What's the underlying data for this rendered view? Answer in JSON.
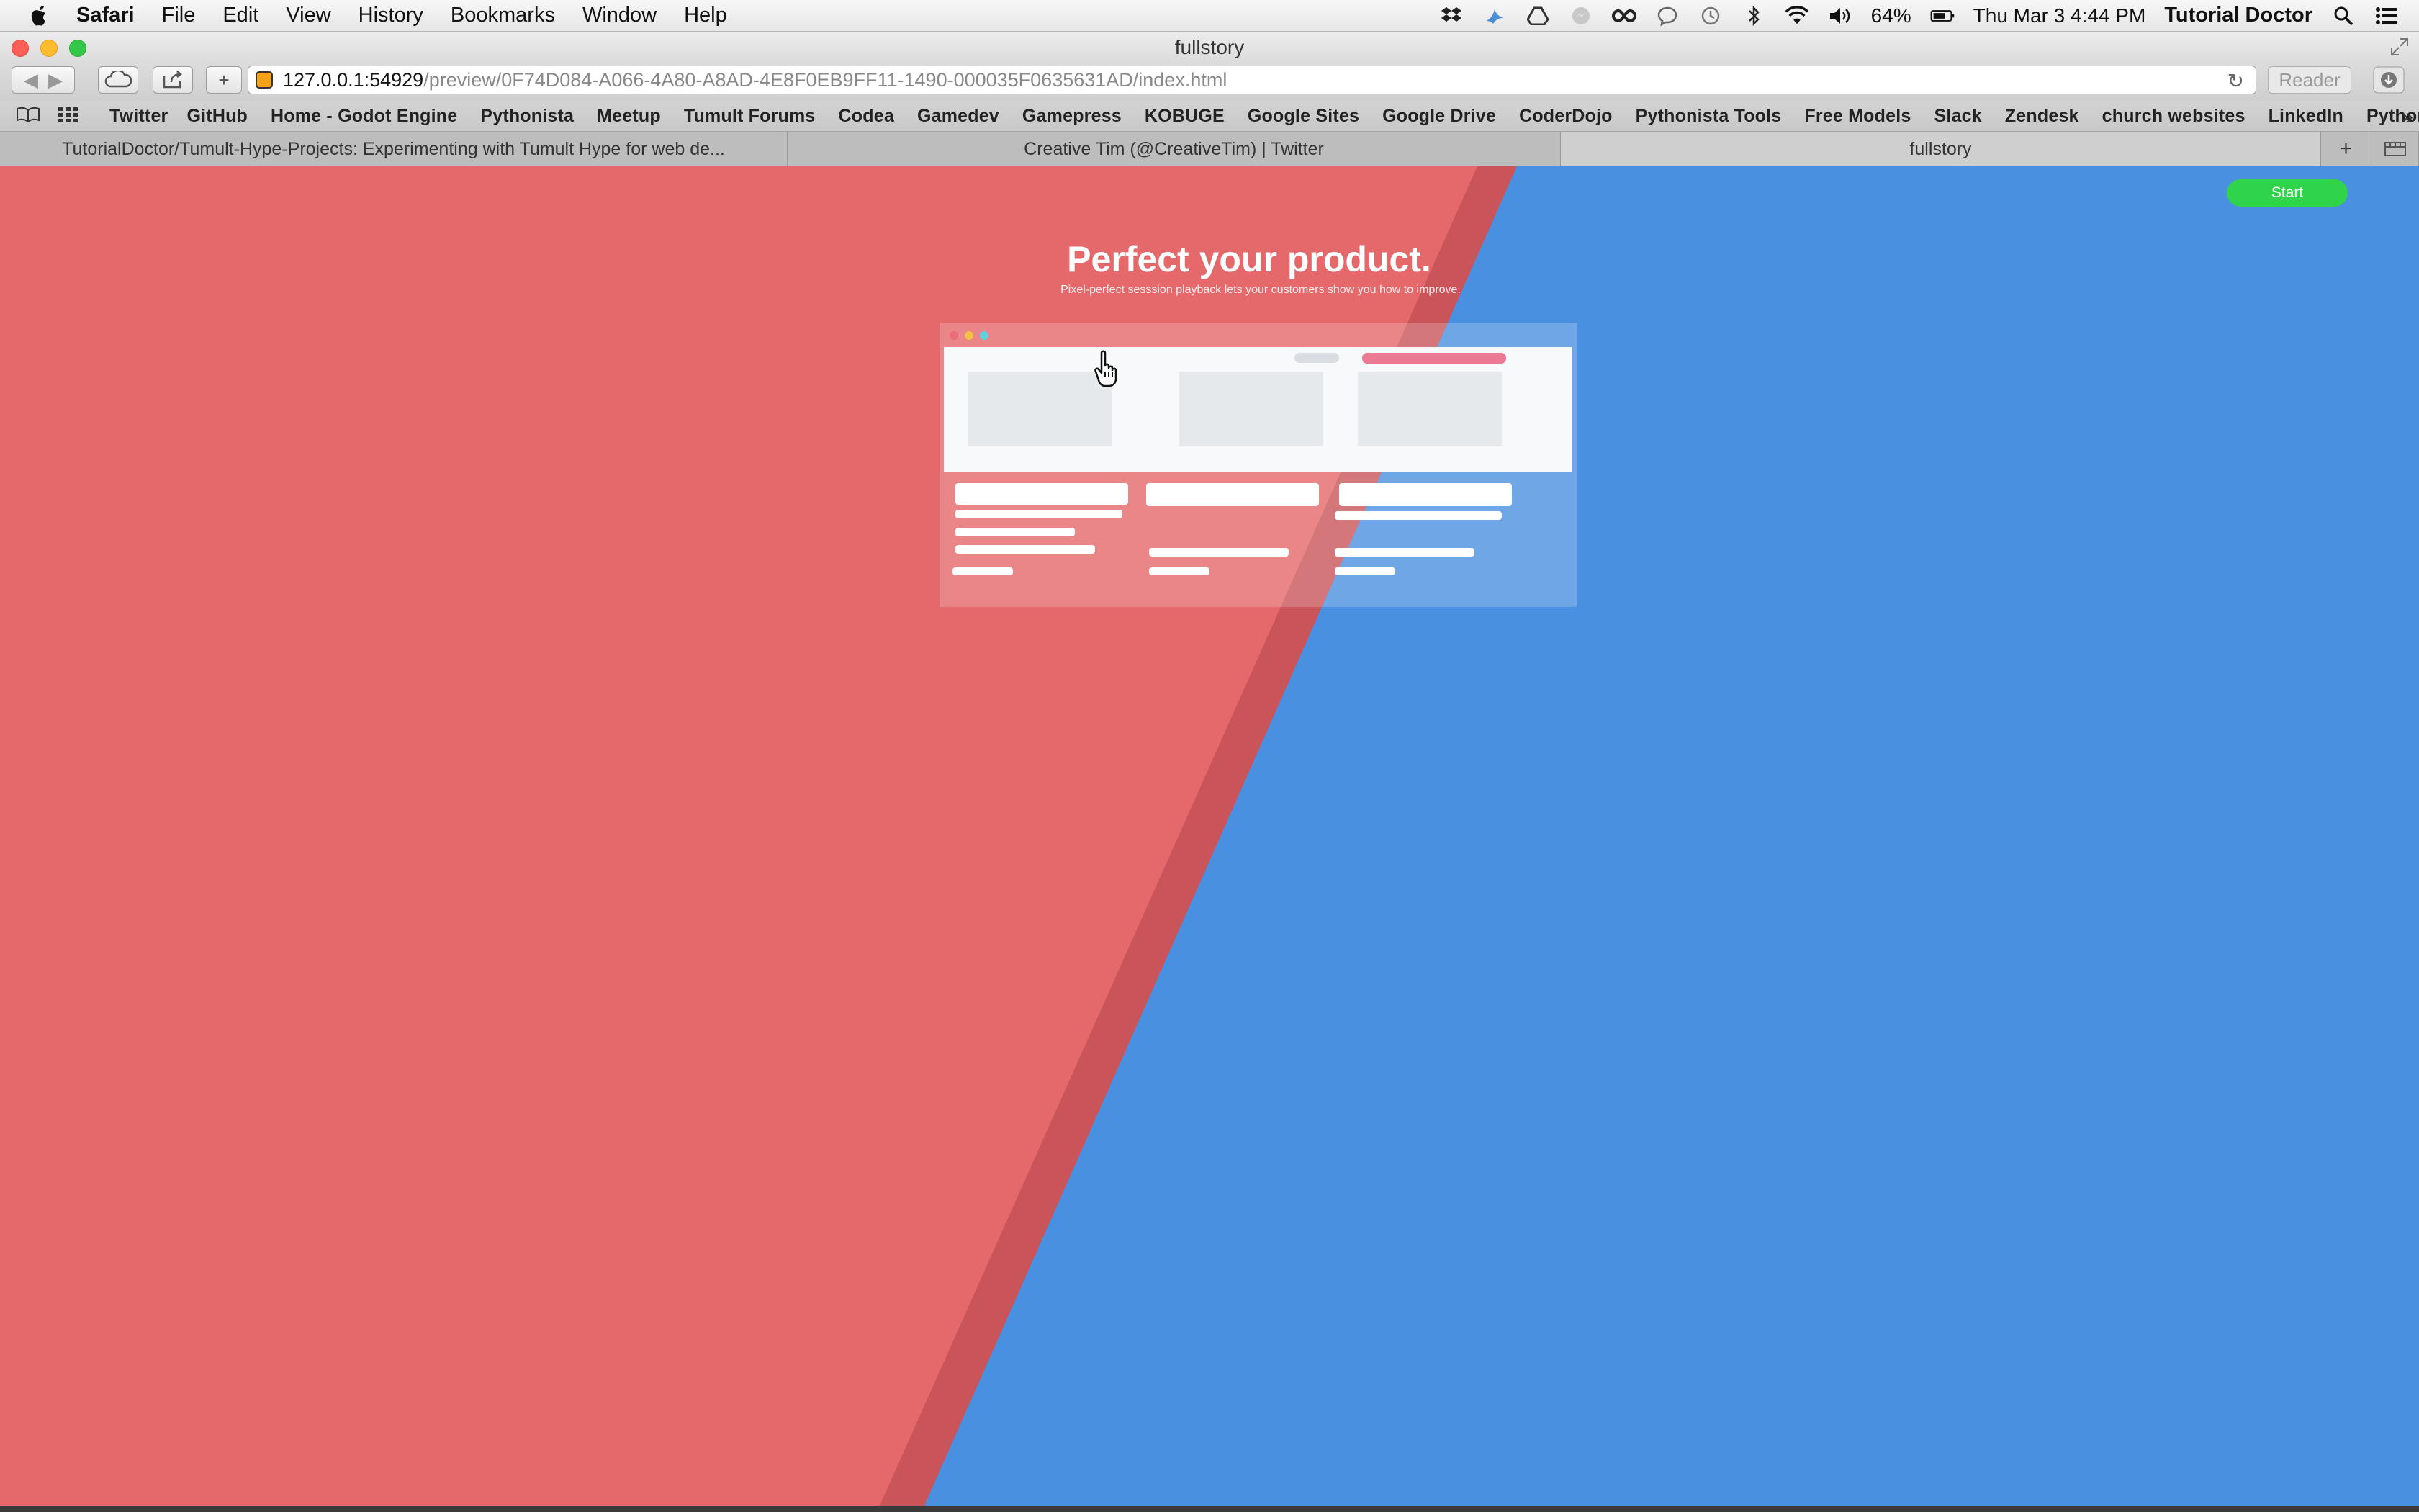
{
  "menubar": {
    "app": "Safari",
    "menus": [
      "File",
      "Edit",
      "View",
      "History",
      "Bookmarks",
      "Window",
      "Help"
    ],
    "battery": "64%",
    "clock": "Thu Mar 3  4:44 PM",
    "user": "Tutorial Doctor",
    "status_icons": [
      "dropbox-icon",
      "bird-icon",
      "google-drive-icon",
      "messenger-icon",
      "infinity-icon",
      "chat-icon",
      "time-machine-icon",
      "bluetooth-icon",
      "wifi-icon",
      "volume-icon",
      "battery-icon",
      "spotlight-icon",
      "notification-center-icon"
    ]
  },
  "window": {
    "title": "fullstory"
  },
  "address": {
    "host": "127.0.0.1:54929",
    "path": "/preview/0F74D084-A066-4A80-A8AD-4E8F0EB9FF11-1490-000035F0635631AD/index.html",
    "reader_label": "Reader"
  },
  "bookmarks": [
    "Twitter",
    "GitHub",
    "Home - Godot Engine",
    "Pythonista",
    "Meetup",
    "Tumult Forums",
    "Codea",
    "Gamedev",
    "Gamepress",
    "KOBUGE",
    "Google Sites",
    "Google Drive",
    "CoderDojo",
    "Pythonista Tools",
    "Free Models",
    "Slack",
    "Zendesk",
    "church websites",
    "LinkedIn",
    "PythonCourse"
  ],
  "tabs": [
    {
      "title": "TutorialDoctor/Tumult-Hype-Projects: Experimenting with Tumult Hype for web de...",
      "active": false
    },
    {
      "title": "Creative Tim (@CreativeTim) | Twitter",
      "active": false
    },
    {
      "title": "fullstory",
      "active": true
    }
  ],
  "page": {
    "start_label": "Start",
    "headline": "Perfect your product.",
    "subline": "Pixel-perfect sesssion playback lets your customers show you how to improve.",
    "colors": {
      "red": "#e5686b",
      "red_dark": "#c9555a",
      "blue": "#4a90e0",
      "green": "#2fd44a",
      "pink": "#ec7a94"
    }
  }
}
